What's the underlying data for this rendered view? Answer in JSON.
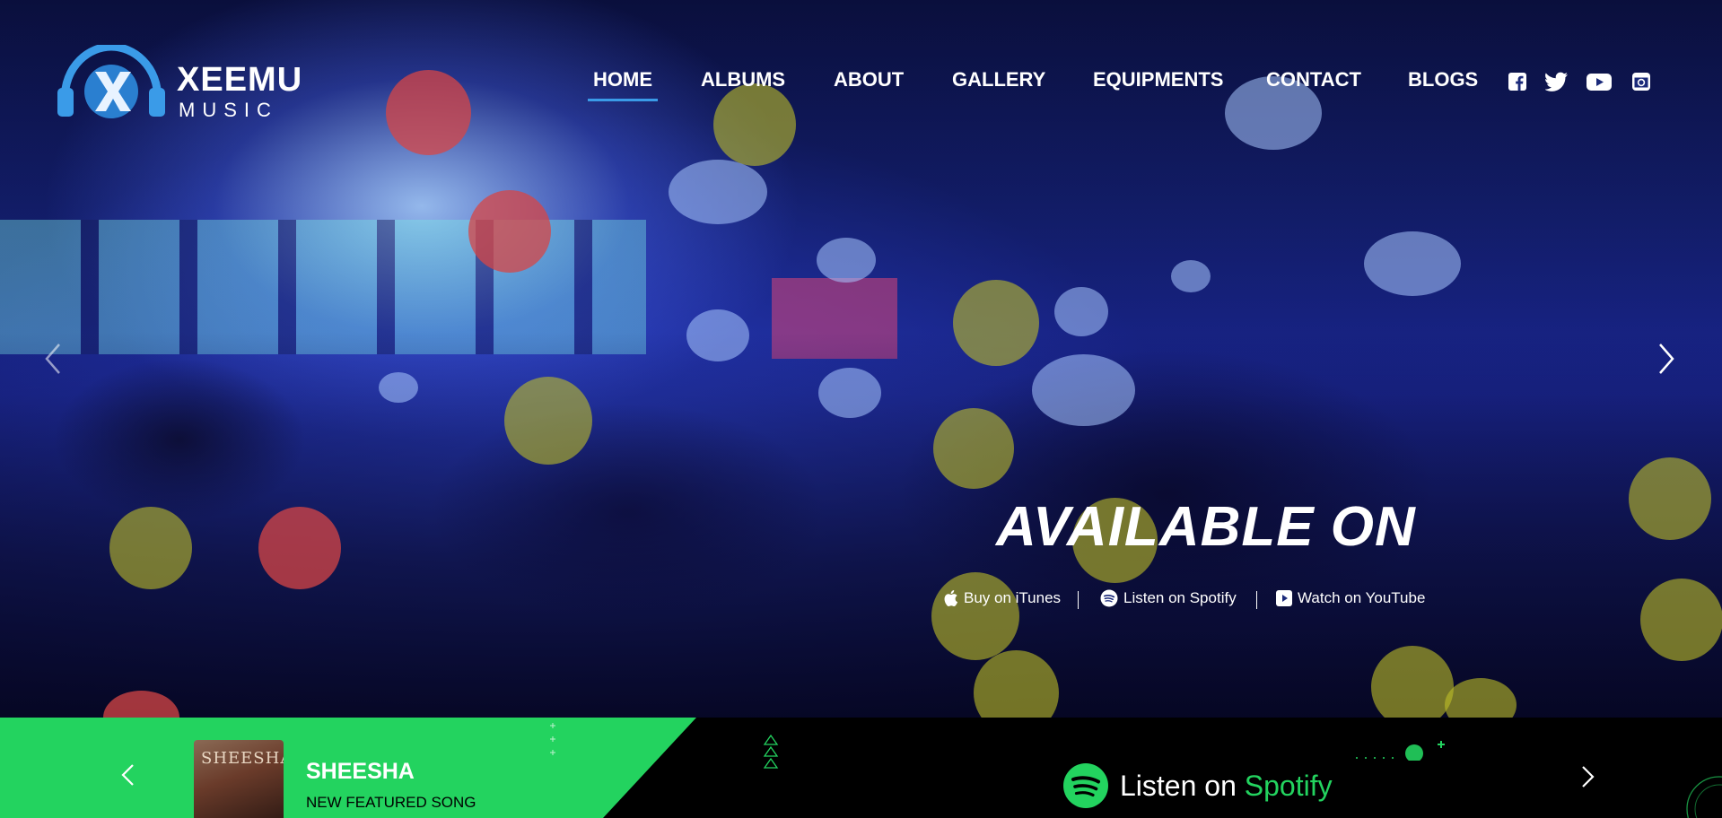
{
  "brand": {
    "name": "XEEMU",
    "tagline": "MUSIC"
  },
  "nav": {
    "items": [
      {
        "label": "HOME",
        "active": true
      },
      {
        "label": "ALBUMS"
      },
      {
        "label": "ABOUT"
      },
      {
        "label": "GALLERY"
      },
      {
        "label": "EQUIPMENTS"
      },
      {
        "label": "CONTACT"
      },
      {
        "label": "BLOGS"
      }
    ]
  },
  "social": [
    "facebook-icon",
    "twitter-icon",
    "youtube-icon",
    "instagram-icon"
  ],
  "hero": {
    "headline": "AVAILABLE ON",
    "links": [
      {
        "label": "Buy on iTunes",
        "icon": "apple-icon"
      },
      {
        "label": "Listen on Spotify",
        "icon": "spotify-icon"
      },
      {
        "label": "Watch on YouTube",
        "icon": "youtube-icon"
      }
    ]
  },
  "featured": {
    "album_art_text": "SHEESHA",
    "title": "SHEESHA",
    "subtitle": "NEW FEATURED SONG"
  },
  "spotify_cta": {
    "prefix": "Listen on",
    "brand": "Spotify"
  },
  "colors": {
    "accent_green": "#23d35f",
    "nav_underline": "#3a9be8",
    "logo_blue": "#3a9be8"
  }
}
